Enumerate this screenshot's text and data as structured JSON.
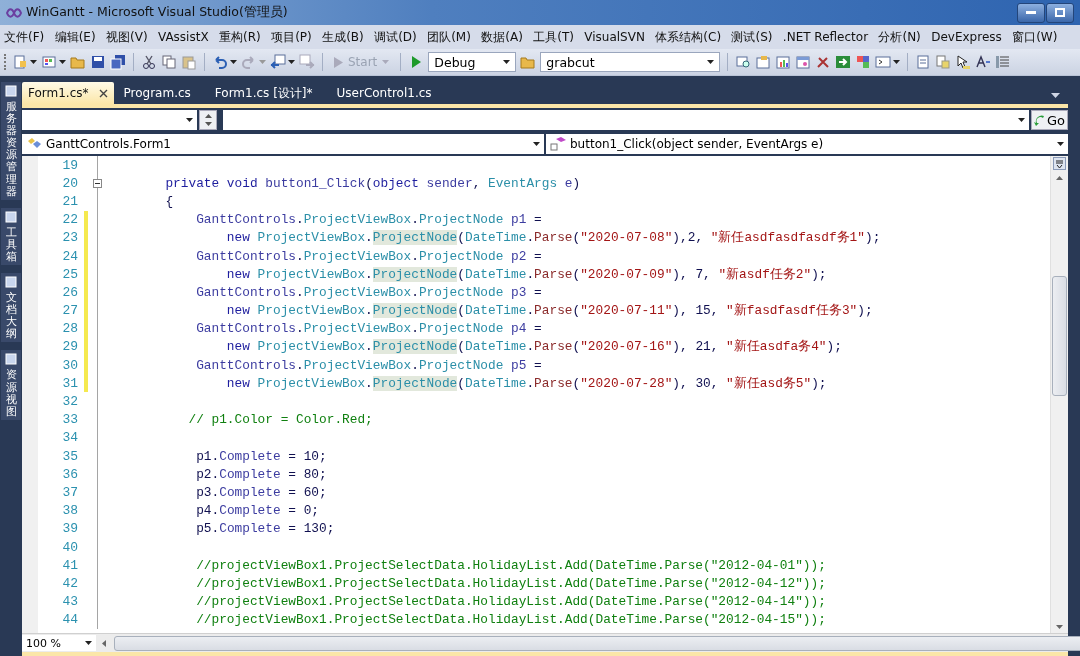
{
  "window": {
    "title": "WinGantt - Microsoft Visual Studio(管理员)"
  },
  "menu": [
    "文件(F)",
    "编辑(E)",
    "视图(V)",
    "VAssistX",
    "重构(R)",
    "项目(P)",
    "生成(B)",
    "调试(D)",
    "团队(M)",
    "数据(A)",
    "工具(T)",
    "VisualSVN",
    "体系结构(C)",
    "测试(S)",
    ".NET Reflector",
    "分析(N)",
    "DevExpress",
    "窗口(W)"
  ],
  "toolbar": {
    "start": {
      "label": "Start",
      "disabled": true
    },
    "configuration": "Debug",
    "find_box": "grabcut"
  },
  "tabs": [
    {
      "label": "Form1.cs*",
      "selected": true
    },
    {
      "label": "Program.cs",
      "selected": false
    },
    {
      "label": "Form1.cs [设计]*",
      "selected": false
    },
    {
      "label": "UserControl1.cs",
      "selected": false
    }
  ],
  "side_panels": [
    "服务器资源管理器",
    "工具箱",
    "文档大纲",
    "资源视图"
  ],
  "navigation": {
    "go": "Go",
    "type": "GanttControls.Form1",
    "member": "button1_Click(object sender, EventArgs e)"
  },
  "editor": {
    "zoom": "100 %",
    "lines": [
      {
        "number": "19",
        "modified": false
      },
      {
        "number": "20",
        "modified": false,
        "foldable": true,
        "tokens": [
          {
            "kind": "keyword",
            "text": "        private void "
          },
          {
            "kind": "ident",
            "text": "button1_Click"
          },
          {
            "kind": "plain",
            "text": "("
          },
          {
            "kind": "keyword",
            "text": "object "
          },
          {
            "kind": "ident",
            "text": "sender"
          },
          {
            "kind": "plain",
            "text": ", "
          },
          {
            "kind": "type",
            "text": "EventArgs "
          },
          {
            "kind": "ident",
            "text": "e"
          },
          {
            "kind": "plain",
            "text": ")"
          }
        ]
      },
      {
        "number": "21",
        "modified": false,
        "tokens": [
          {
            "kind": "plain",
            "text": "        {"
          }
        ]
      },
      {
        "number": "22",
        "modified": true,
        "tokens": [
          {
            "kind": "ident",
            "text": "            GanttControls"
          },
          {
            "kind": "plain",
            "text": "."
          },
          {
            "kind": "type",
            "text": "ProjectViewBox"
          },
          {
            "kind": "plain",
            "text": "."
          },
          {
            "kind": "type",
            "text": "ProjectNode"
          },
          {
            "kind": "ident",
            "text": " p1"
          },
          {
            "kind": "plain",
            "text": " ="
          }
        ]
      },
      {
        "number": "23",
        "modified": true,
        "tokens": [
          {
            "kind": "keyword",
            "text": "                new "
          },
          {
            "kind": "type",
            "text": "ProjectViewBox"
          },
          {
            "kind": "plain",
            "text": "."
          },
          {
            "kind": "highlight",
            "text": "ProjectNode"
          },
          {
            "kind": "plain",
            "text": "("
          },
          {
            "kind": "type",
            "text": "DateTime"
          },
          {
            "kind": "plain",
            "text": "."
          },
          {
            "kind": "method",
            "text": "Parse"
          },
          {
            "kind": "plain",
            "text": "("
          },
          {
            "kind": "string",
            "text": "\"2020-07-08\""
          },
          {
            "kind": "plain",
            "text": "),2, "
          },
          {
            "kind": "string",
            "text": "\"新任asdfasdfasdf务1\""
          },
          {
            "kind": "plain",
            "text": ");"
          }
        ]
      },
      {
        "number": "24",
        "modified": true,
        "tokens": [
          {
            "kind": "ident",
            "text": "            GanttControls"
          },
          {
            "kind": "plain",
            "text": "."
          },
          {
            "kind": "type",
            "text": "ProjectViewBox"
          },
          {
            "kind": "plain",
            "text": "."
          },
          {
            "kind": "type",
            "text": "ProjectNode"
          },
          {
            "kind": "ident",
            "text": " p2"
          },
          {
            "kind": "plain",
            "text": " ="
          }
        ]
      },
      {
        "number": "25",
        "modified": true,
        "tokens": [
          {
            "kind": "keyword",
            "text": "                new "
          },
          {
            "kind": "type",
            "text": "ProjectViewBox"
          },
          {
            "kind": "plain",
            "text": "."
          },
          {
            "kind": "highlight",
            "text": "ProjectNode"
          },
          {
            "kind": "plain",
            "text": "("
          },
          {
            "kind": "type",
            "text": "DateTime"
          },
          {
            "kind": "plain",
            "text": "."
          },
          {
            "kind": "method",
            "text": "Parse"
          },
          {
            "kind": "plain",
            "text": "("
          },
          {
            "kind": "string",
            "text": "\"2020-07-09\""
          },
          {
            "kind": "plain",
            "text": "), 7, "
          },
          {
            "kind": "string",
            "text": "\"新asdf任务2\""
          },
          {
            "kind": "plain",
            "text": ");"
          }
        ]
      },
      {
        "number": "26",
        "modified": true,
        "tokens": [
          {
            "kind": "ident",
            "text": "            GanttControls"
          },
          {
            "kind": "plain",
            "text": "."
          },
          {
            "kind": "type",
            "text": "ProjectViewBox"
          },
          {
            "kind": "plain",
            "text": "."
          },
          {
            "kind": "type",
            "text": "ProjectNode"
          },
          {
            "kind": "ident",
            "text": " p3"
          },
          {
            "kind": "plain",
            "text": " ="
          }
        ]
      },
      {
        "number": "27",
        "modified": true,
        "tokens": [
          {
            "kind": "keyword",
            "text": "                new "
          },
          {
            "kind": "type",
            "text": "ProjectViewBox"
          },
          {
            "kind": "plain",
            "text": "."
          },
          {
            "kind": "highlight",
            "text": "ProjectNode"
          },
          {
            "kind": "plain",
            "text": "("
          },
          {
            "kind": "type",
            "text": "DateTime"
          },
          {
            "kind": "plain",
            "text": "."
          },
          {
            "kind": "method",
            "text": "Parse"
          },
          {
            "kind": "plain",
            "text": "("
          },
          {
            "kind": "string",
            "text": "\"2020-07-11\""
          },
          {
            "kind": "plain",
            "text": "), 15, "
          },
          {
            "kind": "string",
            "text": "\"新fasdfasdf任务3\""
          },
          {
            "kind": "plain",
            "text": ");"
          }
        ]
      },
      {
        "number": "28",
        "modified": true,
        "tokens": [
          {
            "kind": "ident",
            "text": "            GanttControls"
          },
          {
            "kind": "plain",
            "text": "."
          },
          {
            "kind": "type",
            "text": "ProjectViewBox"
          },
          {
            "kind": "plain",
            "text": "."
          },
          {
            "kind": "type",
            "text": "ProjectNode"
          },
          {
            "kind": "ident",
            "text": " p4"
          },
          {
            "kind": "plain",
            "text": " ="
          }
        ]
      },
      {
        "number": "29",
        "modified": true,
        "tokens": [
          {
            "kind": "keyword",
            "text": "                new "
          },
          {
            "kind": "type",
            "text": "ProjectViewBox"
          },
          {
            "kind": "plain",
            "text": "."
          },
          {
            "kind": "highlight",
            "text": "ProjectNode"
          },
          {
            "kind": "plain",
            "text": "("
          },
          {
            "kind": "type",
            "text": "DateTime"
          },
          {
            "kind": "plain",
            "text": "."
          },
          {
            "kind": "method",
            "text": "Parse"
          },
          {
            "kind": "plain",
            "text": "("
          },
          {
            "kind": "string",
            "text": "\"2020-07-16\""
          },
          {
            "kind": "plain",
            "text": "), 21, "
          },
          {
            "kind": "string",
            "text": "\"新任asdfa务4\""
          },
          {
            "kind": "plain",
            "text": ");"
          }
        ]
      },
      {
        "number": "30",
        "modified": true,
        "tokens": [
          {
            "kind": "ident",
            "text": "            GanttControls"
          },
          {
            "kind": "plain",
            "text": "."
          },
          {
            "kind": "type",
            "text": "ProjectViewBox"
          },
          {
            "kind": "plain",
            "text": "."
          },
          {
            "kind": "type",
            "text": "ProjectNode"
          },
          {
            "kind": "ident",
            "text": " p5"
          },
          {
            "kind": "plain",
            "text": " ="
          }
        ]
      },
      {
        "number": "31",
        "modified": true,
        "tokens": [
          {
            "kind": "keyword",
            "text": "                new "
          },
          {
            "kind": "type",
            "text": "ProjectViewBox"
          },
          {
            "kind": "plain",
            "text": "."
          },
          {
            "kind": "highlight",
            "text": "ProjectNode"
          },
          {
            "kind": "plain",
            "text": "("
          },
          {
            "kind": "type",
            "text": "DateTime"
          },
          {
            "kind": "plain",
            "text": "."
          },
          {
            "kind": "method",
            "text": "Parse"
          },
          {
            "kind": "plain",
            "text": "("
          },
          {
            "kind": "string",
            "text": "\"2020-07-28\""
          },
          {
            "kind": "plain",
            "text": "), 30, "
          },
          {
            "kind": "string",
            "text": "\"新任asd务5\""
          },
          {
            "kind": "plain",
            "text": ");"
          }
        ]
      },
      {
        "number": "32",
        "modified": false
      },
      {
        "number": "33",
        "modified": false,
        "tokens": [
          {
            "kind": "comment",
            "text": "           // p1.Color = Color.Red;"
          }
        ]
      },
      {
        "number": "34",
        "modified": false
      },
      {
        "number": "35",
        "modified": false,
        "tokens": [
          {
            "kind": "plain",
            "text": "            p1."
          },
          {
            "kind": "ident",
            "text": "Complete"
          },
          {
            "kind": "plain",
            "text": " = 10;"
          }
        ]
      },
      {
        "number": "36",
        "modified": false,
        "tokens": [
          {
            "kind": "plain",
            "text": "            p2."
          },
          {
            "kind": "ident",
            "text": "Complete"
          },
          {
            "kind": "plain",
            "text": " = 80;"
          }
        ]
      },
      {
        "number": "37",
        "modified": false,
        "tokens": [
          {
            "kind": "plain",
            "text": "            p3."
          },
          {
            "kind": "ident",
            "text": "Complete"
          },
          {
            "kind": "plain",
            "text": " = 60;"
          }
        ]
      },
      {
        "number": "38",
        "modified": false,
        "tokens": [
          {
            "kind": "plain",
            "text": "            p4."
          },
          {
            "kind": "ident",
            "text": "Complete"
          },
          {
            "kind": "plain",
            "text": " = 0;"
          }
        ]
      },
      {
        "number": "39",
        "modified": false,
        "tokens": [
          {
            "kind": "plain",
            "text": "            p5."
          },
          {
            "kind": "ident",
            "text": "Complete"
          },
          {
            "kind": "plain",
            "text": " = 130;"
          }
        ]
      },
      {
        "number": "40",
        "modified": false
      },
      {
        "number": "41",
        "modified": false,
        "tokens": [
          {
            "kind": "comment",
            "text": "            //projectViewBox1.ProjectSelectData.HolidayList.Add(DateTime.Parse(\"2012-04-01\"));"
          }
        ]
      },
      {
        "number": "42",
        "modified": false,
        "tokens": [
          {
            "kind": "comment",
            "text": "            //projectViewBox1.ProjectSelectData.HolidayList.Add(DateTime.Parse(\"2012-04-12\"));"
          }
        ]
      },
      {
        "number": "43",
        "modified": false,
        "tokens": [
          {
            "kind": "comment",
            "text": "            //projectViewBox1.ProjectSelectData.HolidayList.Add(DateTime.Parse(\"2012-04-14\"));"
          }
        ]
      },
      {
        "number": "44",
        "modified": false,
        "tokens": [
          {
            "kind": "comment",
            "text": "            //projectViewBox1.ProjectSelectData.HolidayList.Add(DateTime.Parse(\"2012-04-15\"));"
          }
        ]
      }
    ]
  }
}
